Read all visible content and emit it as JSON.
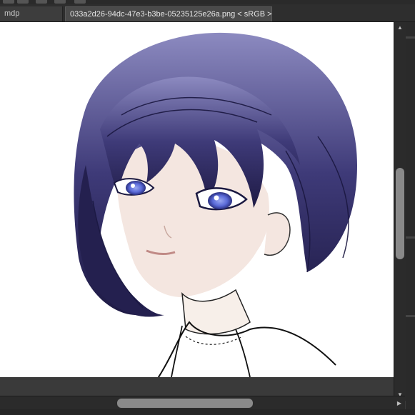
{
  "tabs": [
    {
      "label": "mdp",
      "active": false
    },
    {
      "label": "033a2d26-94dc-47e3-b3be-05235125e26a.png < sRGB >",
      "active": true
    }
  ],
  "canvas": {
    "subject": "illustration",
    "hair_color": "#3e3a78",
    "eye_color": "#5a6ad8",
    "skin_color": "#f4e6e0"
  },
  "colors": {
    "ui_background": "#3a3a3a",
    "scrollbar_thumb": "#8a8a8a"
  },
  "icons": {
    "scroll_up": "chevron-up-icon",
    "scroll_down": "chevron-down-icon",
    "scroll_right": "chevron-right-icon"
  }
}
